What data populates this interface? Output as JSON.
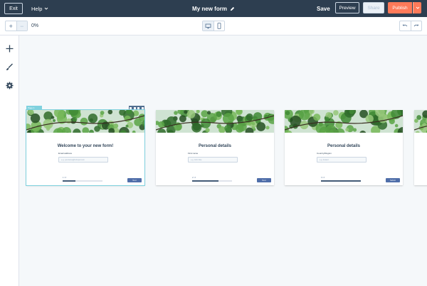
{
  "topbar": {
    "exit_label": "Exit",
    "help_label": "Help",
    "form_title": "My new form",
    "save_label": "Save",
    "preview_label": "Preview",
    "share_label": "Share",
    "publish_label": "Publish"
  },
  "toolbar": {
    "zoom_in_symbol": "+",
    "zoom_out_symbol": "−",
    "zoom_level": "0%",
    "devices": [
      "desktop-icon",
      "mobile-icon"
    ],
    "history": [
      "undo-icon",
      "redo-icon"
    ]
  },
  "sidebar": {
    "items": [
      {
        "icon": "plus-icon"
      },
      {
        "icon": "brush-icon"
      },
      {
        "icon": "gear-icon"
      }
    ]
  },
  "canvas": {
    "selected_tab": "Page 1",
    "pages": [
      {
        "heading": "Welcome to your new form!",
        "field_label": "Email address",
        "placeholder": "e.g. yourname@hubspot.com",
        "progress_label": "1 / 3",
        "progress": 0.33,
        "button_label": "Next",
        "selected": true
      },
      {
        "heading": "Personal details",
        "field_label": "First name",
        "placeholder": "e.g. John Doe",
        "progress_label": "2 / 3",
        "progress": 0.66,
        "button_label": "Next",
        "selected": false
      },
      {
        "heading": "Personal details",
        "field_label": "Country/Region",
        "placeholder": "e.g. Ireland",
        "progress_label": "3 / 3",
        "progress": 1.0,
        "button_label": "Submit",
        "selected": false
      }
    ]
  },
  "colors": {
    "topbar_bg": "#2d3e50",
    "publish": "#ff7a59",
    "selection": "#7fd1de",
    "primary_button": "#4f6ea9"
  }
}
